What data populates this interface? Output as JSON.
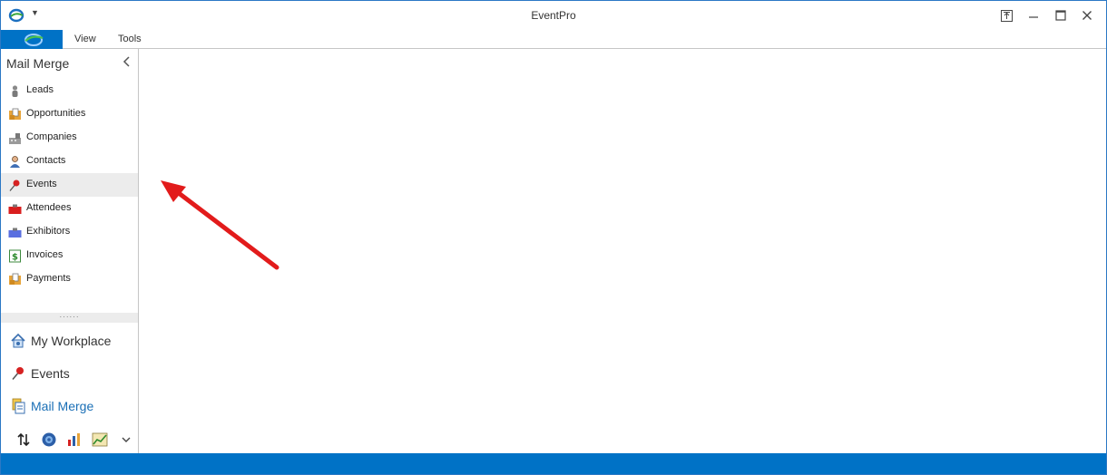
{
  "window": {
    "title": "EventPro"
  },
  "ribbon": {
    "tabs": [
      "View",
      "Tools"
    ]
  },
  "nav": {
    "header": "Mail Merge",
    "items": [
      {
        "label": "Leads",
        "icon": "person-icon"
      },
      {
        "label": "Opportunities",
        "icon": "opportunity-icon"
      },
      {
        "label": "Companies",
        "icon": "building-icon"
      },
      {
        "label": "Contacts",
        "icon": "contact-icon"
      },
      {
        "label": "Events",
        "icon": "pushpin-icon",
        "active": true
      },
      {
        "label": "Attendees",
        "icon": "red-badge-icon"
      },
      {
        "label": "Exhibitors",
        "icon": "blue-badge-icon"
      },
      {
        "label": "Invoices",
        "icon": "dollar-icon"
      },
      {
        "label": "Payments",
        "icon": "payment-icon"
      }
    ],
    "modules": [
      {
        "label": "My Workplace",
        "icon": "home-icon"
      },
      {
        "label": "Events",
        "icon": "pushpin-icon"
      },
      {
        "label": "Mail Merge",
        "icon": "mail-merge-icon",
        "selected": true
      }
    ],
    "bottom_icons": [
      "sort-arrows-icon",
      "globe-icon",
      "bar-chart-icon",
      "line-chart-icon",
      "chevron-down-icon"
    ]
  },
  "colors": {
    "accent": "#0072c6",
    "annotation": "#e21b1b",
    "active_bg": "#ececec"
  }
}
